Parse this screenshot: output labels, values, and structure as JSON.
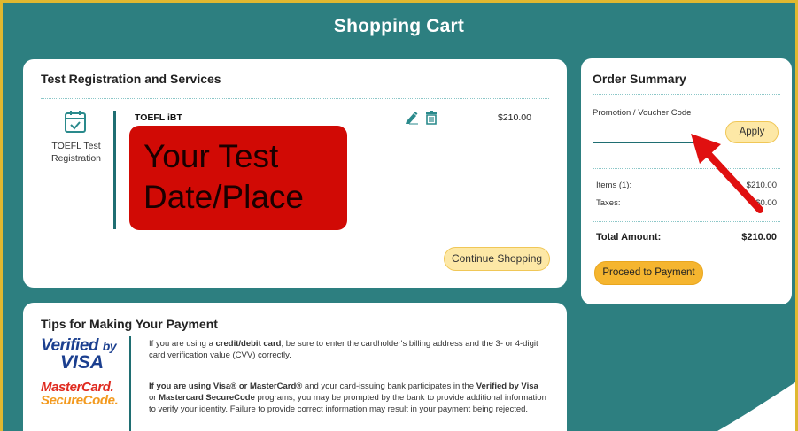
{
  "header": {
    "title": "Shopping Cart"
  },
  "registration": {
    "section_title": "Test Registration and Services",
    "item_icon": "calendar-check-icon",
    "item_label": "TOEFL Test Registration",
    "product_name": "TOEFL iBT",
    "price": "$210.00",
    "overlay_text": "Your Test Date/Place",
    "continue_label": "Continue Shopping"
  },
  "tips": {
    "section_title": "Tips for Making Your Payment",
    "logos": {
      "visa_line1": "Verified",
      "visa_by": "by",
      "visa_line2": "VISA",
      "mc_line1": "MasterCard.",
      "mc_line2": "SecureCode."
    },
    "para1": {
      "pre": "If you are using a ",
      "bold": "credit/debit card",
      "post": ", be sure to enter the cardholder's billing address and the 3- or 4-digit card verification value (CVV) correctly."
    },
    "para2": {
      "bold1": "If you are using Visa® or MasterCard®",
      "mid1": " and your card-issuing bank participates in the ",
      "bold2": "Verified by Visa",
      "mid2": " or ",
      "bold3": "Mastercard SecureCode",
      "post": " programs, you may be prompted by the bank to provide additional information to verify your identity. Failure to provide correct information may result in your payment being rejected."
    }
  },
  "summary": {
    "title": "Order Summary",
    "promo_label": "Promotion / Voucher Code",
    "promo_value": "",
    "apply_label": "Apply",
    "items_label": "Items (1):",
    "items_value": "$210.00",
    "taxes_label": "Taxes:",
    "taxes_value": "$0.00",
    "total_label": "Total Amount:",
    "total_value": "$210.00",
    "proceed_label": "Proceed to Payment"
  },
  "colors": {
    "background": "#2d7f80",
    "frame_border": "#e0b830",
    "overlay_red": "#d10a05",
    "arrow_red": "#e01010",
    "accent_teal": "#1f6e72",
    "pill_yellow": "#fde8a6",
    "proceed_orange": "#f5b52f"
  }
}
